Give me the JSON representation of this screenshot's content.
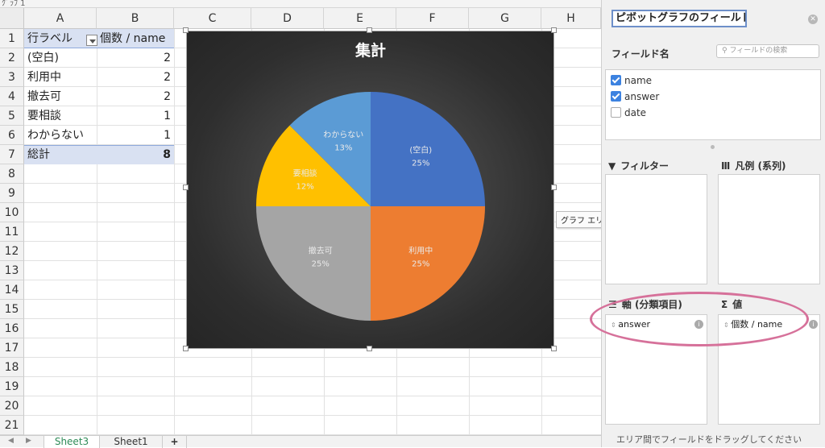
{
  "topbar": {
    "text": "ｸﾞﾗﾌ 1"
  },
  "columns": [
    "A",
    "B",
    "C",
    "D",
    "E",
    "F",
    "G",
    "H"
  ],
  "rows": [
    "1",
    "2",
    "3",
    "4",
    "5",
    "6",
    "7",
    "8",
    "9",
    "10",
    "11",
    "12",
    "13",
    "14",
    "15",
    "16",
    "17",
    "18",
    "19",
    "20",
    "21"
  ],
  "pivot": {
    "header_a": "行ラベル",
    "header_b": "個数 / name",
    "rows": [
      {
        "label": "(空白)",
        "value": "2"
      },
      {
        "label": "利用中",
        "value": "2"
      },
      {
        "label": "撤去可",
        "value": "2"
      },
      {
        "label": "要相談",
        "value": "1"
      },
      {
        "label": "わからない",
        "value": "1"
      }
    ],
    "total_label": "総計",
    "total_value": "8"
  },
  "chart_data": {
    "type": "pie",
    "title": "集計",
    "categories": [
      "(空白)",
      "利用中",
      "撤去可",
      "要相談",
      "わからない"
    ],
    "values": [
      2,
      2,
      2,
      1,
      1
    ],
    "percent_labels": [
      "25%",
      "25%",
      "25%",
      "12%",
      "13%"
    ],
    "colors": [
      "#4472c4",
      "#ed7d31",
      "#a5a5a5",
      "#ffc000",
      "#5b9bd5"
    ]
  },
  "tooltip": "グラフ エリア",
  "tabs": {
    "active": "Sheet3",
    "other": "Sheet1",
    "add": "+"
  },
  "panel": {
    "title": "ピボットグラフのフィールド",
    "field_name_label": "フィールド名",
    "search_placeholder": "フィールドの検索",
    "fields": [
      {
        "name": "name",
        "checked": true
      },
      {
        "name": "answer",
        "checked": true
      },
      {
        "name": "date",
        "checked": false
      }
    ],
    "filter_label": "フィルター",
    "legend_label": "凡例 (系列)",
    "axis_label": "軸 (分類項目)",
    "values_label": "値",
    "axis_field": "answer",
    "values_field": "個数 / name",
    "hint": "エリア間でフィールドをドラッグしてください"
  }
}
